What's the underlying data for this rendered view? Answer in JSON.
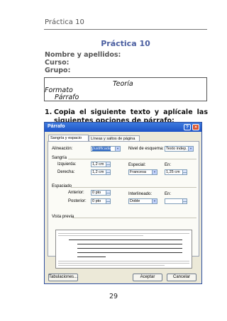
{
  "header": {
    "running_title": "Práctica 10"
  },
  "title": "Práctica 10",
  "meta": {
    "name_label": "Nombre y apellidos:",
    "course_label": "Curso:",
    "group_label": "Grupo:"
  },
  "theory_box": {
    "heading": "Teoría",
    "line1": "Formato",
    "line2": "Párrafo"
  },
  "question": {
    "number": "1.",
    "text": "Copia el siguiente texto y aplícale las siguientes opciones de párrafo:"
  },
  "dialog": {
    "title": "Párrafo",
    "help_icon": "?",
    "close_icon": "×",
    "tabs": [
      "Sangría y espacio",
      "Líneas y saltos de página"
    ],
    "alignment_label": "Alineación:",
    "alignment_value": "Justificada",
    "outline_label": "Nivel de esquema:",
    "outline_value": "Texto indep.",
    "indent_section": "Sangría",
    "left_label": "Izquierda:",
    "left_value": "1,2 cm",
    "right_label": "Derecha:",
    "right_value": "1,2 cm",
    "special_label": "Especial:",
    "special_value": "Francesa",
    "by_label": "En:",
    "by_value": "1,25 cm",
    "spacing_section": "Espaciado",
    "before_label": "Anterior:",
    "before_value": "0 pto",
    "after_label": "Posterior:",
    "after_value": "0 pto",
    "line_label": "Interlineado:",
    "line_value": "Doble",
    "at_label": "En:",
    "at_value": "",
    "preview_label": "Vista previa",
    "tabs_button": "Tabulaciones...",
    "ok_button": "Aceptar",
    "cancel_button": "Cancelar"
  },
  "page_number": "29"
}
